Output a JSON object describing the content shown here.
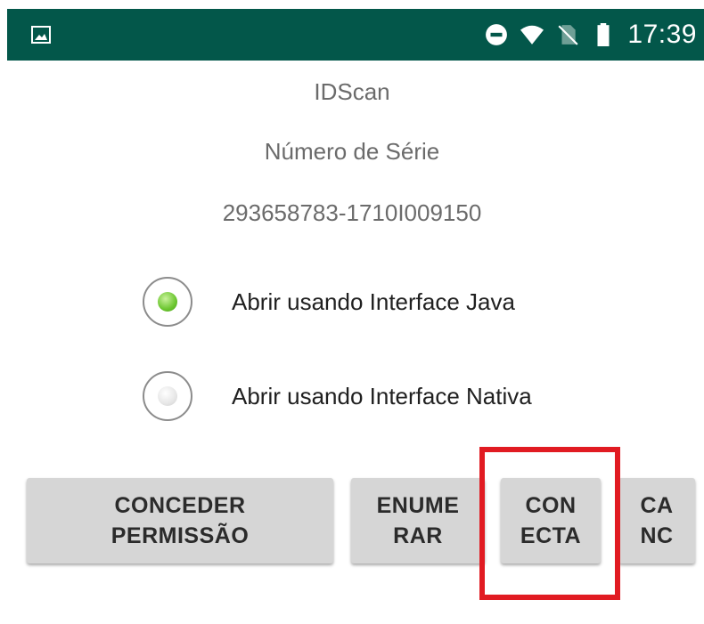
{
  "status_bar": {
    "background_color": "#03574a",
    "left_icon": "image-icon",
    "right_icons": [
      "do-not-disturb-icon",
      "wifi-icon",
      "no-sim-icon",
      "battery-icon"
    ],
    "time": "17:39"
  },
  "main": {
    "app_name": "IDScan",
    "serial_label": "Número de Série",
    "serial_value": "293658783-1710I009150"
  },
  "options": [
    {
      "label": "Abrir usando Interface Java",
      "selected": true
    },
    {
      "label": "Abrir usando Interface Nativa",
      "selected": false
    }
  ],
  "buttons": {
    "conceder": "CONCEDER\nPERMISSÃO",
    "enumerar": "ENUME\nRAR",
    "conecta": "CON\nECTA",
    "canc": "CA\nNC"
  },
  "annotation": {
    "highlight_color": "#e11b22",
    "highlighted": "conecta"
  }
}
